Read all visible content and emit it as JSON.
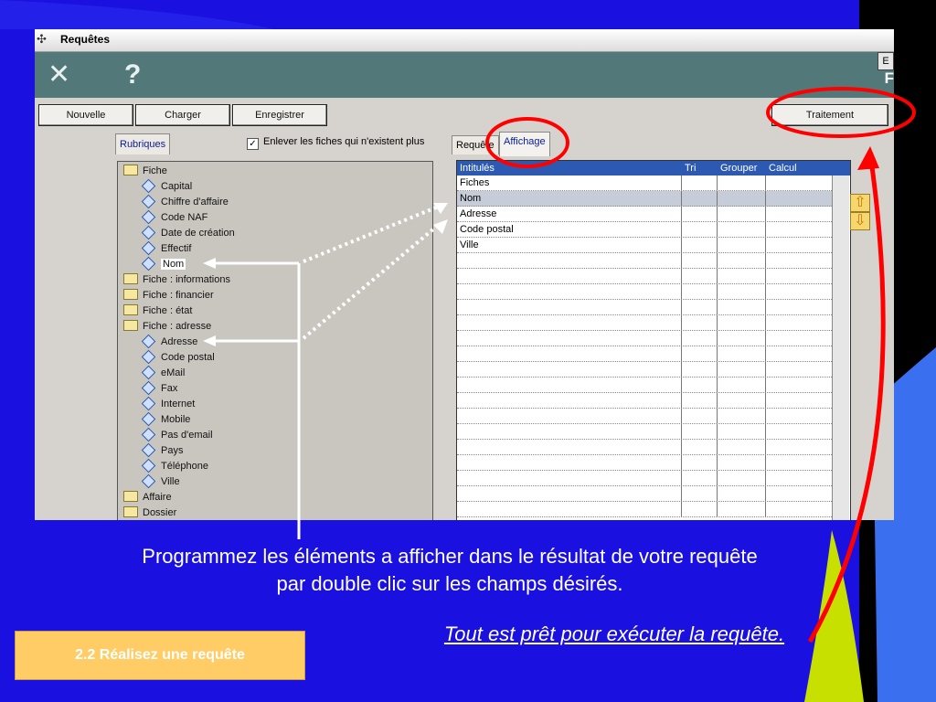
{
  "window": {
    "title": "Requêtes",
    "app_icon": "network-icon",
    "toolbar": {
      "tools_icon": "tools-icon",
      "help_icon": "help-icon",
      "edge_button": "E",
      "edge_text": "F"
    },
    "buttons": {
      "nouvelle": "Nouvelle",
      "charger": "Charger",
      "enregistrer": "Enregistrer",
      "traitement": "Traitement"
    },
    "left_panel": {
      "tab": "Rubriques",
      "checkbox_checked": true,
      "checkbox_label": "Enlever les fiches qui n'existent plus",
      "tree": [
        {
          "label": "Fiche",
          "type": "folder-open"
        },
        {
          "label": "Capital",
          "type": "leaf"
        },
        {
          "label": "Chiffre d'affaire",
          "type": "leaf"
        },
        {
          "label": "Code NAF",
          "type": "leaf"
        },
        {
          "label": "Date de création",
          "type": "leaf"
        },
        {
          "label": "Effectif",
          "type": "leaf"
        },
        {
          "label": "Nom",
          "type": "leaf"
        },
        {
          "label": "Fiche : informations",
          "type": "folder"
        },
        {
          "label": "Fiche : financier",
          "type": "folder"
        },
        {
          "label": "Fiche : état",
          "type": "folder"
        },
        {
          "label": "Fiche : adresse",
          "type": "folder-open"
        },
        {
          "label": "Adresse",
          "type": "leaf"
        },
        {
          "label": "Code postal",
          "type": "leaf"
        },
        {
          "label": "eMail",
          "type": "leaf"
        },
        {
          "label": "Fax",
          "type": "leaf"
        },
        {
          "label": "Internet",
          "type": "leaf"
        },
        {
          "label": "Mobile",
          "type": "leaf"
        },
        {
          "label": "Pas d'email",
          "type": "leaf"
        },
        {
          "label": "Pays",
          "type": "leaf"
        },
        {
          "label": "Téléphone",
          "type": "leaf"
        },
        {
          "label": "Ville",
          "type": "leaf"
        },
        {
          "label": "Affaire",
          "type": "folder"
        },
        {
          "label": "Dossier",
          "type": "folder"
        }
      ]
    },
    "right_panel": {
      "tabs": [
        "Requête",
        "Affichage"
      ],
      "active_tab": "Affichage",
      "columns": [
        "Intitulés",
        "Tri",
        "Grouper",
        "Calcul"
      ],
      "rows": [
        "Fiches",
        "Nom",
        "Adresse",
        "Code postal",
        "Ville"
      ],
      "selected_row": "Nom",
      "move_up_icon": "arrow-up-icon",
      "move_down_icon": "arrow-down-icon"
    }
  },
  "slide": {
    "caption_line1": "Programmez les éléments a afficher dans le résultat de votre requête",
    "caption_line2": "par double clic sur les champs désirés.",
    "note": "Tout est prêt pour exécuter la requête.",
    "badge": "2.2 Réalisez une requête"
  },
  "colors": {
    "slide_bg": "#1a10e0",
    "toolbar": "#53787a",
    "grid_header": "#2c5ab3",
    "highlight_red": "#ff0000",
    "badge": "#ffcc66"
  }
}
